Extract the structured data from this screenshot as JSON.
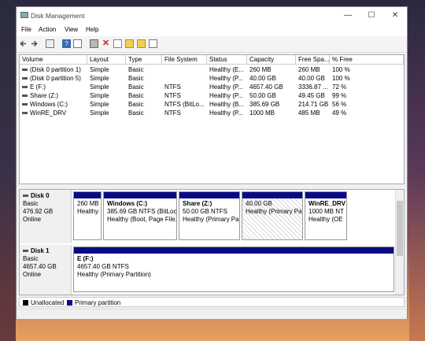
{
  "window": {
    "title": "Disk Management"
  },
  "menu": [
    "File",
    "Action",
    "View",
    "Help"
  ],
  "toolbar": [
    "back-icon",
    "forward-icon",
    "console-tree-icon",
    "help-icon",
    "properties-icon",
    "connect-icon",
    "delete-icon",
    "check-icon",
    "new-folder-icon",
    "open-icon",
    "view-icon"
  ],
  "columns": [
    "Volume",
    "Layout",
    "Type",
    "File System",
    "Status",
    "Capacity",
    "Free Spa...",
    "% Free"
  ],
  "volumes": [
    [
      "(Disk 0 partition 1)",
      "Simple",
      "Basic",
      "",
      "Healthy (E...",
      "260 MB",
      "260 MB",
      "100 %"
    ],
    [
      "(Disk 0 partition 5)",
      "Simple",
      "Basic",
      "",
      "Healthy (P...",
      "40.00 GB",
      "40.00 GB",
      "100 %"
    ],
    [
      "E (F:)",
      "Simple",
      "Basic",
      "NTFS",
      "Healthy (P...",
      "4657.40 GB",
      "3336.87 ...",
      "72 %"
    ],
    [
      "Share (Z:)",
      "Simple",
      "Basic",
      "NTFS",
      "Healthy (P...",
      "50.00 GB",
      "49.45 GB",
      "99 %"
    ],
    [
      "Windows (C:)",
      "Simple",
      "Basic",
      "NTFS (BitLo...",
      "Healthy (B...",
      "385.69 GB",
      "214.71 GB",
      "56 %"
    ],
    [
      "WinRE_DRV",
      "Simple",
      "Basic",
      "NTFS",
      "Healthy (P...",
      "1000 MB",
      "485 MB",
      "49 %"
    ]
  ],
  "disks": [
    {
      "name": "Disk 0",
      "type": "Basic",
      "size": "476.92 GB",
      "status": "Online",
      "partitions": [
        {
          "name": "",
          "line1": "260 MB",
          "line2": "Healthy (",
          "hatched": false
        },
        {
          "name": "Windows (C:)",
          "line1": "385.69 GB NTFS (BitLock",
          "line2": "Healthy (Boot, Page File,",
          "hatched": false
        },
        {
          "name": "Share (Z:)",
          "line1": "50.00 GB NTFS",
          "line2": "Healthy (Primary Pa",
          "hatched": false
        },
        {
          "name": "",
          "line1": "40.00 GB",
          "line2": "Healthy (Primary Pa",
          "hatched": true
        },
        {
          "name": "WinRE_DRV",
          "line1": "1000 MB NT",
          "line2": "Healthy (OE",
          "hatched": false
        }
      ]
    },
    {
      "name": "Disk 1",
      "type": "Basic",
      "size": "4657.40 GB",
      "status": "Online",
      "partitions": [
        {
          "name": "E (F:)",
          "line1": "4657.40 GB NTFS",
          "line2": "Healthy (Primary Partition)",
          "hatched": false
        }
      ]
    }
  ],
  "legend": [
    {
      "label": "Unallocated",
      "color": "#000000"
    },
    {
      "label": "Primary partition",
      "color": "#0a0a88"
    }
  ]
}
